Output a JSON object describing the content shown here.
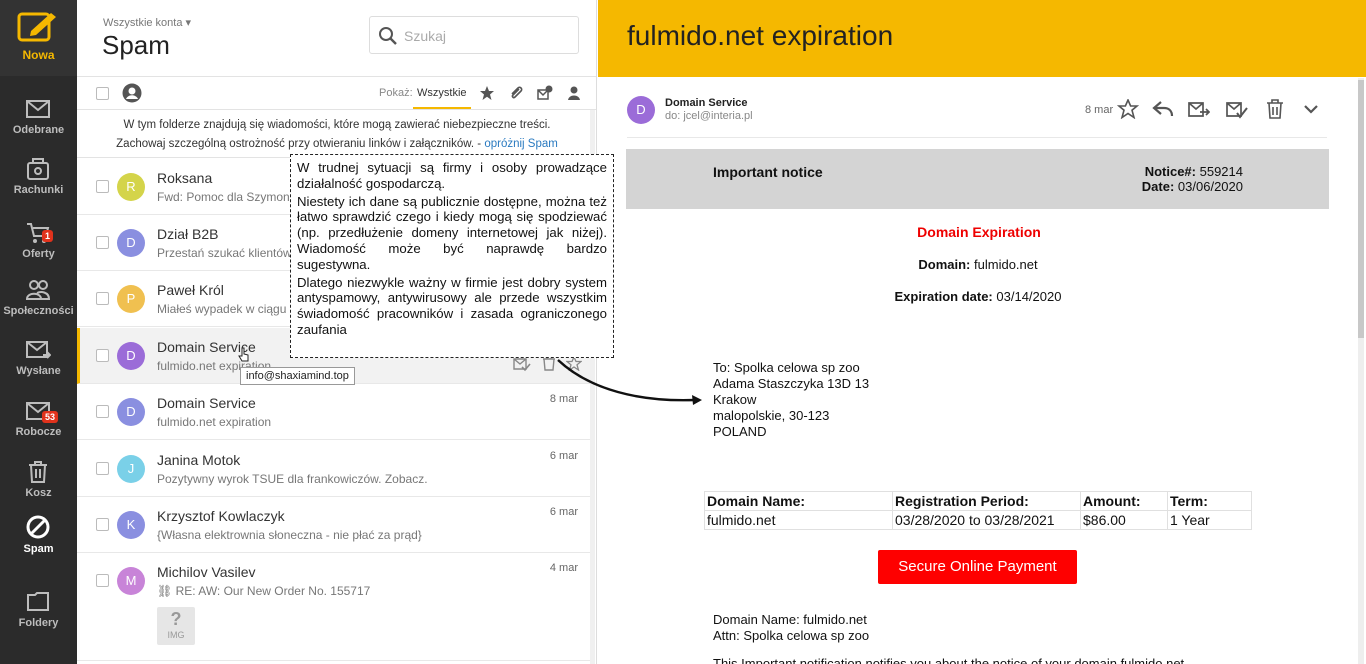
{
  "nav": {
    "new_label": "Nowa",
    "items": [
      {
        "label": "Odebrane",
        "icon": "envelope-icon"
      },
      {
        "label": "Rachunki",
        "icon": "bill-icon"
      },
      {
        "label": "Oferty",
        "icon": "cart-icon",
        "badge": "1"
      },
      {
        "label": "Społeczności",
        "icon": "people-icon"
      },
      {
        "label": "Wysłane",
        "icon": "send-icon"
      },
      {
        "label": "Robocze",
        "icon": "draft-icon",
        "badge": "53"
      },
      {
        "label": "Kosz",
        "icon": "trash-icon"
      },
      {
        "label": "Spam",
        "icon": "spam-icon"
      },
      {
        "label": "Foldery",
        "icon": "folder-icon"
      }
    ]
  },
  "list": {
    "account": "Wszystkie konta",
    "folder_title": "Spam",
    "search_placeholder": "Szukaj",
    "show_label": "Pokaż:",
    "show_value": "Wszystkie",
    "notice_line1": "W tym folderze znajdują się wiadomości, które mogą zawierać niebezpieczne treści.",
    "notice_line2": "Zachowaj szczególną ostrożność przy otwieraniu linków i załączników. - ",
    "notice_link": "opróżnij Spam",
    "messages": [
      {
        "from": "Roksana",
        "subject": "Fwd: Pomoc dla Szymona!",
        "date": "",
        "avatar": "R",
        "color": "#d4d44a"
      },
      {
        "from": "Dział B2B",
        "subject": "Przestań szukać klientów l",
        "date": "",
        "avatar": "D",
        "color": "#8a8fe0"
      },
      {
        "from": "Paweł Król",
        "subject": "Miałeś wypadek w ciągu o",
        "date": "",
        "avatar": "P",
        "color": "#f0c050"
      },
      {
        "from": "Domain Service",
        "subject": "fulmido.net expiration",
        "date": "",
        "avatar": "D",
        "color": "#9b6cd8"
      },
      {
        "from": "Domain Service",
        "subject": "fulmido.net expiration",
        "date": "8 mar",
        "avatar": "D",
        "color": "#8a8fe0"
      },
      {
        "from": "Janina Motok",
        "subject": "Pozytywny wyrok TSUE dla frankowiczów. Zobacz.",
        "date": "6 mar",
        "avatar": "J",
        "color": "#7ad0e8"
      },
      {
        "from": "Krzysztof Kowlaczyk",
        "subject": "{Własna elektrownia słoneczna - nie płać za prąd}",
        "date": "6 mar",
        "avatar": "K",
        "color": "#8a8fe0"
      },
      {
        "from": "Michilov Vasilev",
        "subject": "RE: AW: Our New Order No. 155717",
        "date": "4 mar",
        "avatar": "M",
        "color": "#c884d8"
      }
    ],
    "img_thumb_label": "IMG",
    "tooltip": "info@shaxiamind.top"
  },
  "reader": {
    "title": "fulmido.net expiration",
    "sender_avatar": "D",
    "sender_name": "Domain Service",
    "sender_to": "do: jcel@interia.pl",
    "date": "8 mar",
    "email": {
      "banner_left": "Important notice",
      "notice_label": "Notice#:",
      "notice_value": "559214",
      "date_label": "Date:",
      "date_value": "03/06/2020",
      "heading": "Domain Expiration",
      "domain_label": "Domain:",
      "domain_value": "fulmido.net",
      "exp_label": "Expiration date:",
      "exp_value": "03/14/2020",
      "address": [
        "To: Spolka celowa sp zoo",
        "Adama Staszczyka 13D 13",
        "Krakow",
        "malopolskie, 30-123",
        "POLAND"
      ],
      "table_headers": [
        "Domain Name:",
        "Registration Period:",
        "Amount:",
        "Term:"
      ],
      "table_row": [
        "fulmido.net",
        "03/28/2020 to 03/28/2021",
        "$86.00",
        "1 Year"
      ],
      "pay_button": "Secure Online Payment",
      "footer_line1": "Domain Name: fulmido.net",
      "footer_line2": "Attn: Spolka celowa sp zoo",
      "cut_line": "This Important notification notifies you about the notice of your domain fulmido.net"
    }
  },
  "annotation": {
    "p1": "W trudnej sytuacji są firmy i osoby prowadzące działalność gospodarczą.",
    "p2": "Niestety ich dane są publicznie dostępne, można też łatwo sprawdzić czego i kiedy mogą się spodziewać (np. przedłużenie domeny internetowej jak niżej). Wiadomość może być naprawdę bardzo sugestywna.",
    "p3": "Dlatego niezwykle ważny w firmie jest dobry system antyspamowy, antywirusowy ale przede wszystkim świadomość pracowników i zasada ograniczonego zaufania"
  },
  "colors": {
    "accent": "#f5b800",
    "nav_bg": "#2b2b2b",
    "danger": "#fe0000"
  }
}
